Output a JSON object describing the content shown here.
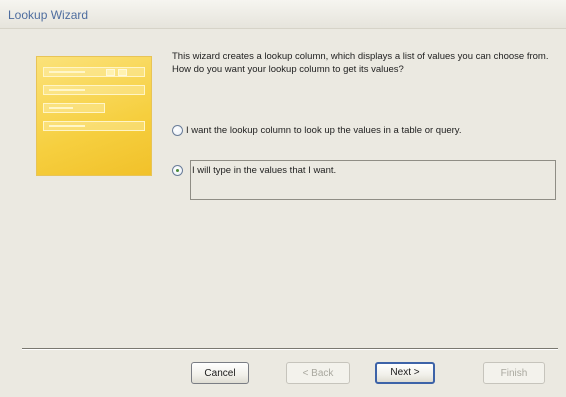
{
  "window": {
    "title": "Lookup Wizard"
  },
  "wizard": {
    "description": "This wizard creates a lookup column, which displays a list of values you can choose from.  How do you want your lookup column to get its values?",
    "options": [
      {
        "label": "I want the lookup column to look up the values in a table or query.",
        "selected": false
      },
      {
        "label": "I will type in the values that I want.",
        "selected": true
      }
    ]
  },
  "buttons": {
    "cancel": "Cancel",
    "back": "< Back",
    "next": "Next >",
    "finish": "Finish"
  }
}
